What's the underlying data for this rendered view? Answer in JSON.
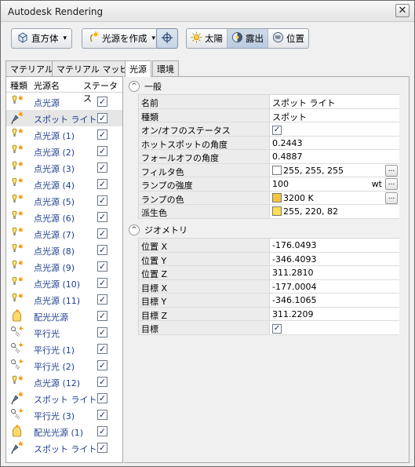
{
  "window": {
    "title": "Autodesk Rendering",
    "close_glyph": "✕"
  },
  "toolbar": {
    "shape_button": "直方体",
    "create_light_button": "光源を作成",
    "sun_label": "太陽",
    "exposure_label": "露出",
    "location_label": "位置"
  },
  "tabs": [
    "マテリアル",
    "マテリアル マッピング",
    "光源",
    "環境"
  ],
  "light_list": {
    "headers": {
      "type": "種類",
      "name": "光源名",
      "status": "ステータス"
    },
    "items": [
      {
        "name": "点光源",
        "icon": "point-light-icon"
      },
      {
        "name": "スポット ライト",
        "icon": "spot-light-icon"
      },
      {
        "name": "点光源 (1)",
        "icon": "point-light-icon"
      },
      {
        "name": "点光源 (2)",
        "icon": "point-light-icon"
      },
      {
        "name": "点光源 (3)",
        "icon": "point-light-icon"
      },
      {
        "name": "点光源 (4)",
        "icon": "point-light-icon"
      },
      {
        "name": "点光源 (5)",
        "icon": "point-light-icon"
      },
      {
        "name": "点光源 (6)",
        "icon": "point-light-icon"
      },
      {
        "name": "点光源 (7)",
        "icon": "point-light-icon"
      },
      {
        "name": "点光源 (8)",
        "icon": "point-light-icon"
      },
      {
        "name": "点光源 (9)",
        "icon": "point-light-icon"
      },
      {
        "name": "点光源 (10)",
        "icon": "point-light-icon"
      },
      {
        "name": "点光源 (11)",
        "icon": "point-light-icon"
      },
      {
        "name": "配光光源",
        "icon": "web-light-icon"
      },
      {
        "name": "平行光",
        "icon": "distant-light-icon"
      },
      {
        "name": "平行光 (1)",
        "icon": "distant-light-icon"
      },
      {
        "name": "平行光 (2)",
        "icon": "distant-light-icon"
      },
      {
        "name": "点光源 (12)",
        "icon": "point-light-icon"
      },
      {
        "name": "スポット ライト",
        "icon": "spot-light-icon"
      },
      {
        "name": "平行光 (3)",
        "icon": "distant-light-icon"
      },
      {
        "name": "配光光源 (1)",
        "icon": "web-light-icon"
      },
      {
        "name": "スポット ライト",
        "icon": "spot-light-icon"
      }
    ],
    "selected_index": 1
  },
  "general": {
    "header": "一般",
    "rows": [
      {
        "key": "名前",
        "value": "スポット ライト"
      },
      {
        "key": "種類",
        "value": "スポット"
      },
      {
        "key": "オン/オフのステータス",
        "value": ""
      },
      {
        "key": "ホットスポットの角度",
        "value": "0.2443"
      },
      {
        "key": "フォールオフの角度",
        "value": "0.4887"
      },
      {
        "key": "フィルタ色",
        "value": "255, 255, 255"
      },
      {
        "key": "ランプの強度",
        "value": "100",
        "unit": "wt"
      },
      {
        "key": "ランプの色",
        "value": "3200 K"
      },
      {
        "key": "派生色",
        "value": "255, 220, 82"
      }
    ],
    "colors": {
      "filter": "#ffffff",
      "lamp": "#f5c542",
      "derived": "#ffdc52"
    }
  },
  "geometry": {
    "header": "ジオメトリ",
    "rows": [
      {
        "key": "位置 X",
        "value": "-176.0493"
      },
      {
        "key": "位置 Y",
        "value": "-346.4093"
      },
      {
        "key": "位置 Z",
        "value": "311.2810"
      },
      {
        "key": "目標 X",
        "value": "-177.0004"
      },
      {
        "key": "目標 Y",
        "value": "-346.1065"
      },
      {
        "key": "目標 Z",
        "value": "311.2209"
      },
      {
        "key": "目標",
        "value": ""
      }
    ]
  },
  "glyphs": {
    "check": "✓",
    "ellipsis": "...",
    "caret": "▾",
    "collapse": "^"
  }
}
